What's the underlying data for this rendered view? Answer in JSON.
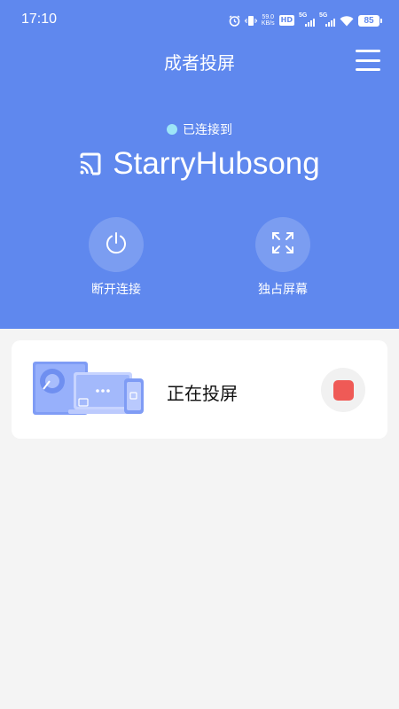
{
  "status_bar": {
    "time": "17:10",
    "net_speed_value": "59.0",
    "net_speed_unit": "KB/s",
    "hd_label": "HD",
    "sim1_label": "5G",
    "sim2_label": "5G",
    "battery": "85"
  },
  "header": {
    "title": "成者投屏",
    "connection_status": "已连接到",
    "device_name": "StarryHubsong"
  },
  "actions": [
    {
      "label": "断开连接",
      "icon": "power-icon"
    },
    {
      "label": "独占屏幕",
      "icon": "expand-icon"
    }
  ],
  "cast_card": {
    "status_text": "正在投屏",
    "stop_icon": "stop-icon"
  },
  "colors": {
    "header_bg": "#5f88ee",
    "background": "#f4f4f4",
    "stop_red": "#ef5a56",
    "connected_dot": "#9de5f7"
  }
}
